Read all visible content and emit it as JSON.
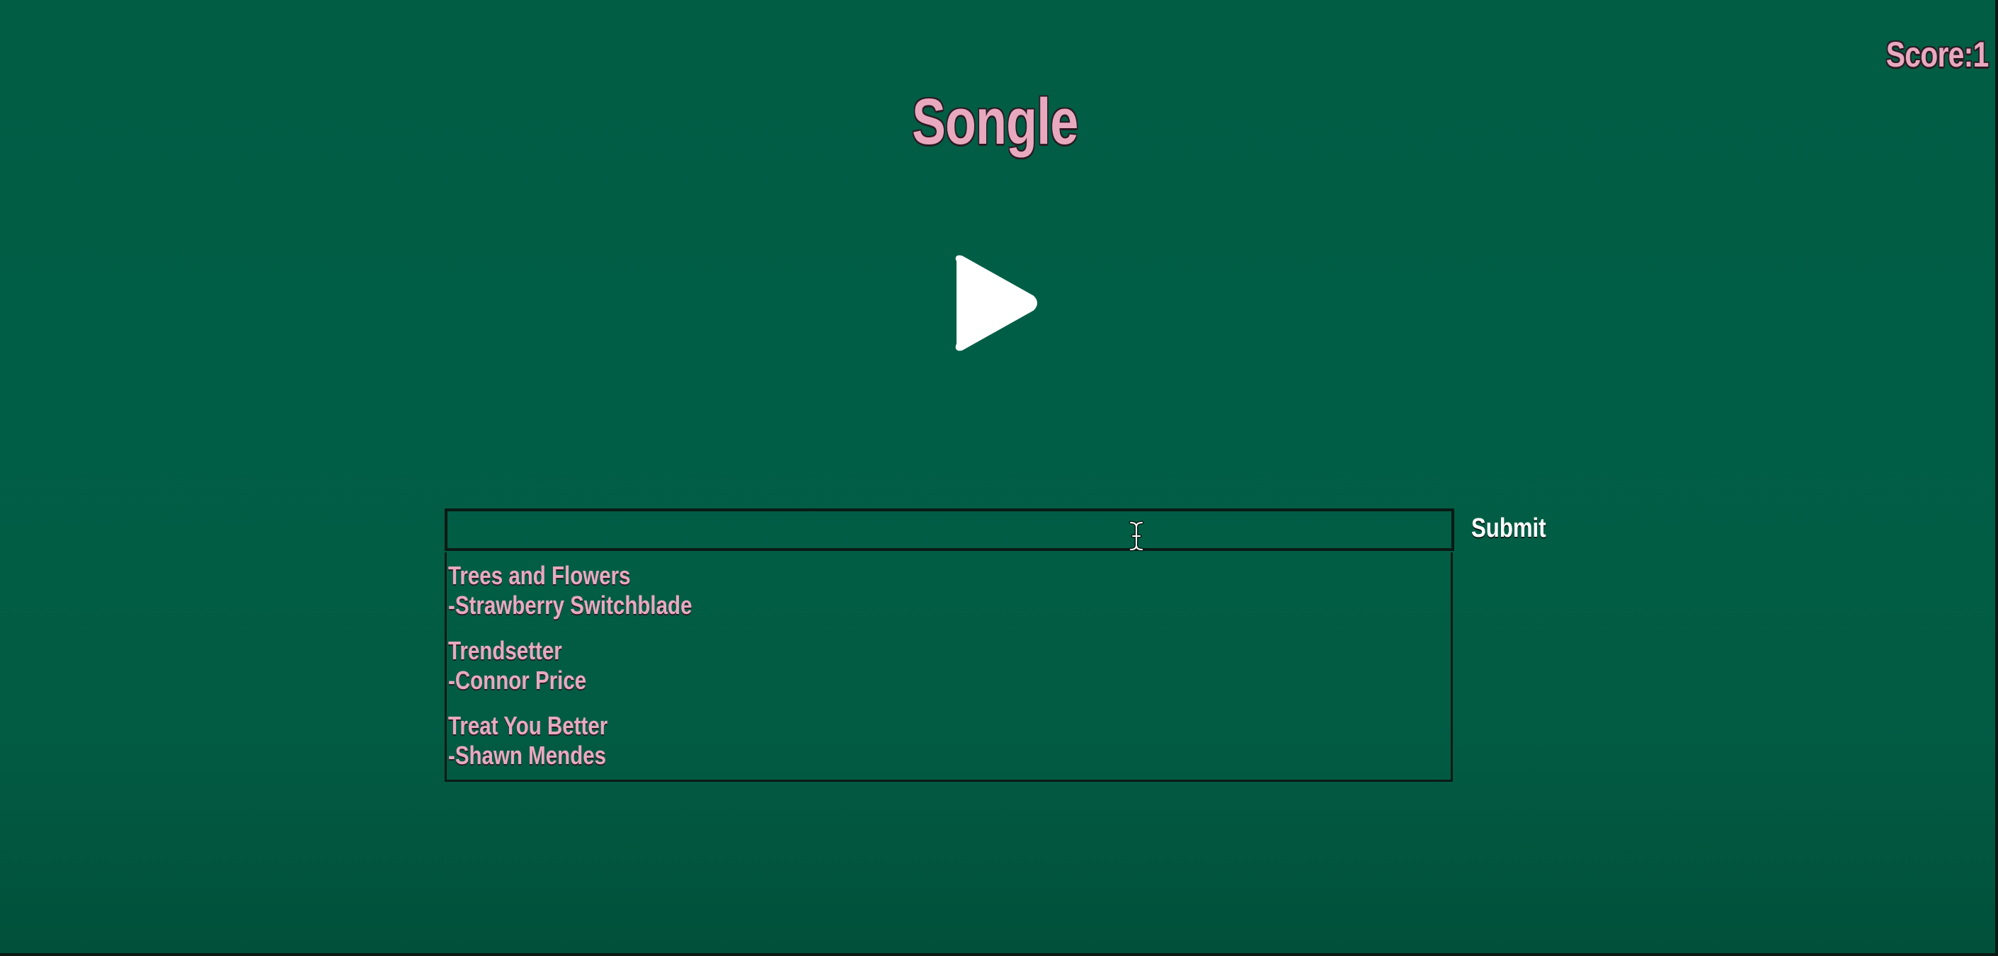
{
  "header": {
    "score_label": "Score:1",
    "title": "Songle"
  },
  "player": {
    "play_icon": "play-icon"
  },
  "guess": {
    "input_value": "",
    "submit_label": "Submit"
  },
  "suggestions": [
    {
      "title": "Trees and Flowers",
      "artist": "-Strawberry Switchblade"
    },
    {
      "title": "Trendsetter",
      "artist": "-Connor Price"
    },
    {
      "title": "Treat You Better",
      "artist": "-Shawn Mendes"
    }
  ],
  "colors": {
    "background": "#015d44",
    "accent_pink": "#e8a9bf",
    "outline_dark": "#0b1a14",
    "play_white": "#ffffff"
  }
}
